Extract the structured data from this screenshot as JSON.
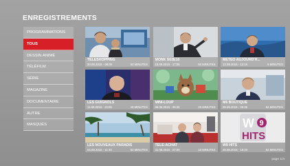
{
  "screen_title": "ENREGISTREMENTS",
  "menu": [
    {
      "label": "PROGRAMMATIONS",
      "active": false
    },
    {
      "label": "TOUS",
      "active": true
    },
    {
      "label": "DESSIN ANIMÉ",
      "active": false
    },
    {
      "label": "TÉLÉFILM",
      "active": false
    },
    {
      "label": "SÉRIE",
      "active": false
    },
    {
      "label": "MAGAZINE",
      "active": false
    },
    {
      "label": "DOCUMENTAIRE",
      "active": false
    },
    {
      "label": "AUTRE",
      "active": false
    },
    {
      "label": "MASQUÉS",
      "active": false
    }
  ],
  "recordings": [
    {
      "title": "TÉLÉSHOPPING",
      "date": "20.08.2015 - 08:05",
      "duration": "52 MINUTES"
    },
    {
      "title": "MONK S03E10",
      "date": "18.09.2015 - 17:05",
      "duration": "60 MINUTES"
    },
    {
      "title": "MÉTÉO AUJOURD'H...",
      "date": "12.09.2015 - 12:15",
      "duration": "6 MINUTES"
    },
    {
      "title": "LES GUIGNOLS",
      "date": "11.09.2015 - 19:05",
      "duration": "18 MINUTES"
    },
    {
      "title": "MINI-LOUP",
      "date": "06.09.2015 - 08:35",
      "duration": "25 MINUTES"
    },
    {
      "title": "M6 BOUTIQUE",
      "date": "06.09.2015 - 06:35",
      "duration": "84 MINUTES"
    },
    {
      "title": "LES NOUVEAUX PARADIS",
      "date": "04.09.2015 - 11:40",
      "duration": "52 MINUTES"
    },
    {
      "title": "TÉLÉ-ACHAT",
      "date": "31.08.2015 - 07:00",
      "duration": "10 MINUTES"
    },
    {
      "title": "W9 HITS",
      "date": "26.08.2015 - 19:20",
      "duration": "52 MINUTES"
    }
  ],
  "logo_text": "W9 HITS",
  "page_indicator": "page 1/4"
}
